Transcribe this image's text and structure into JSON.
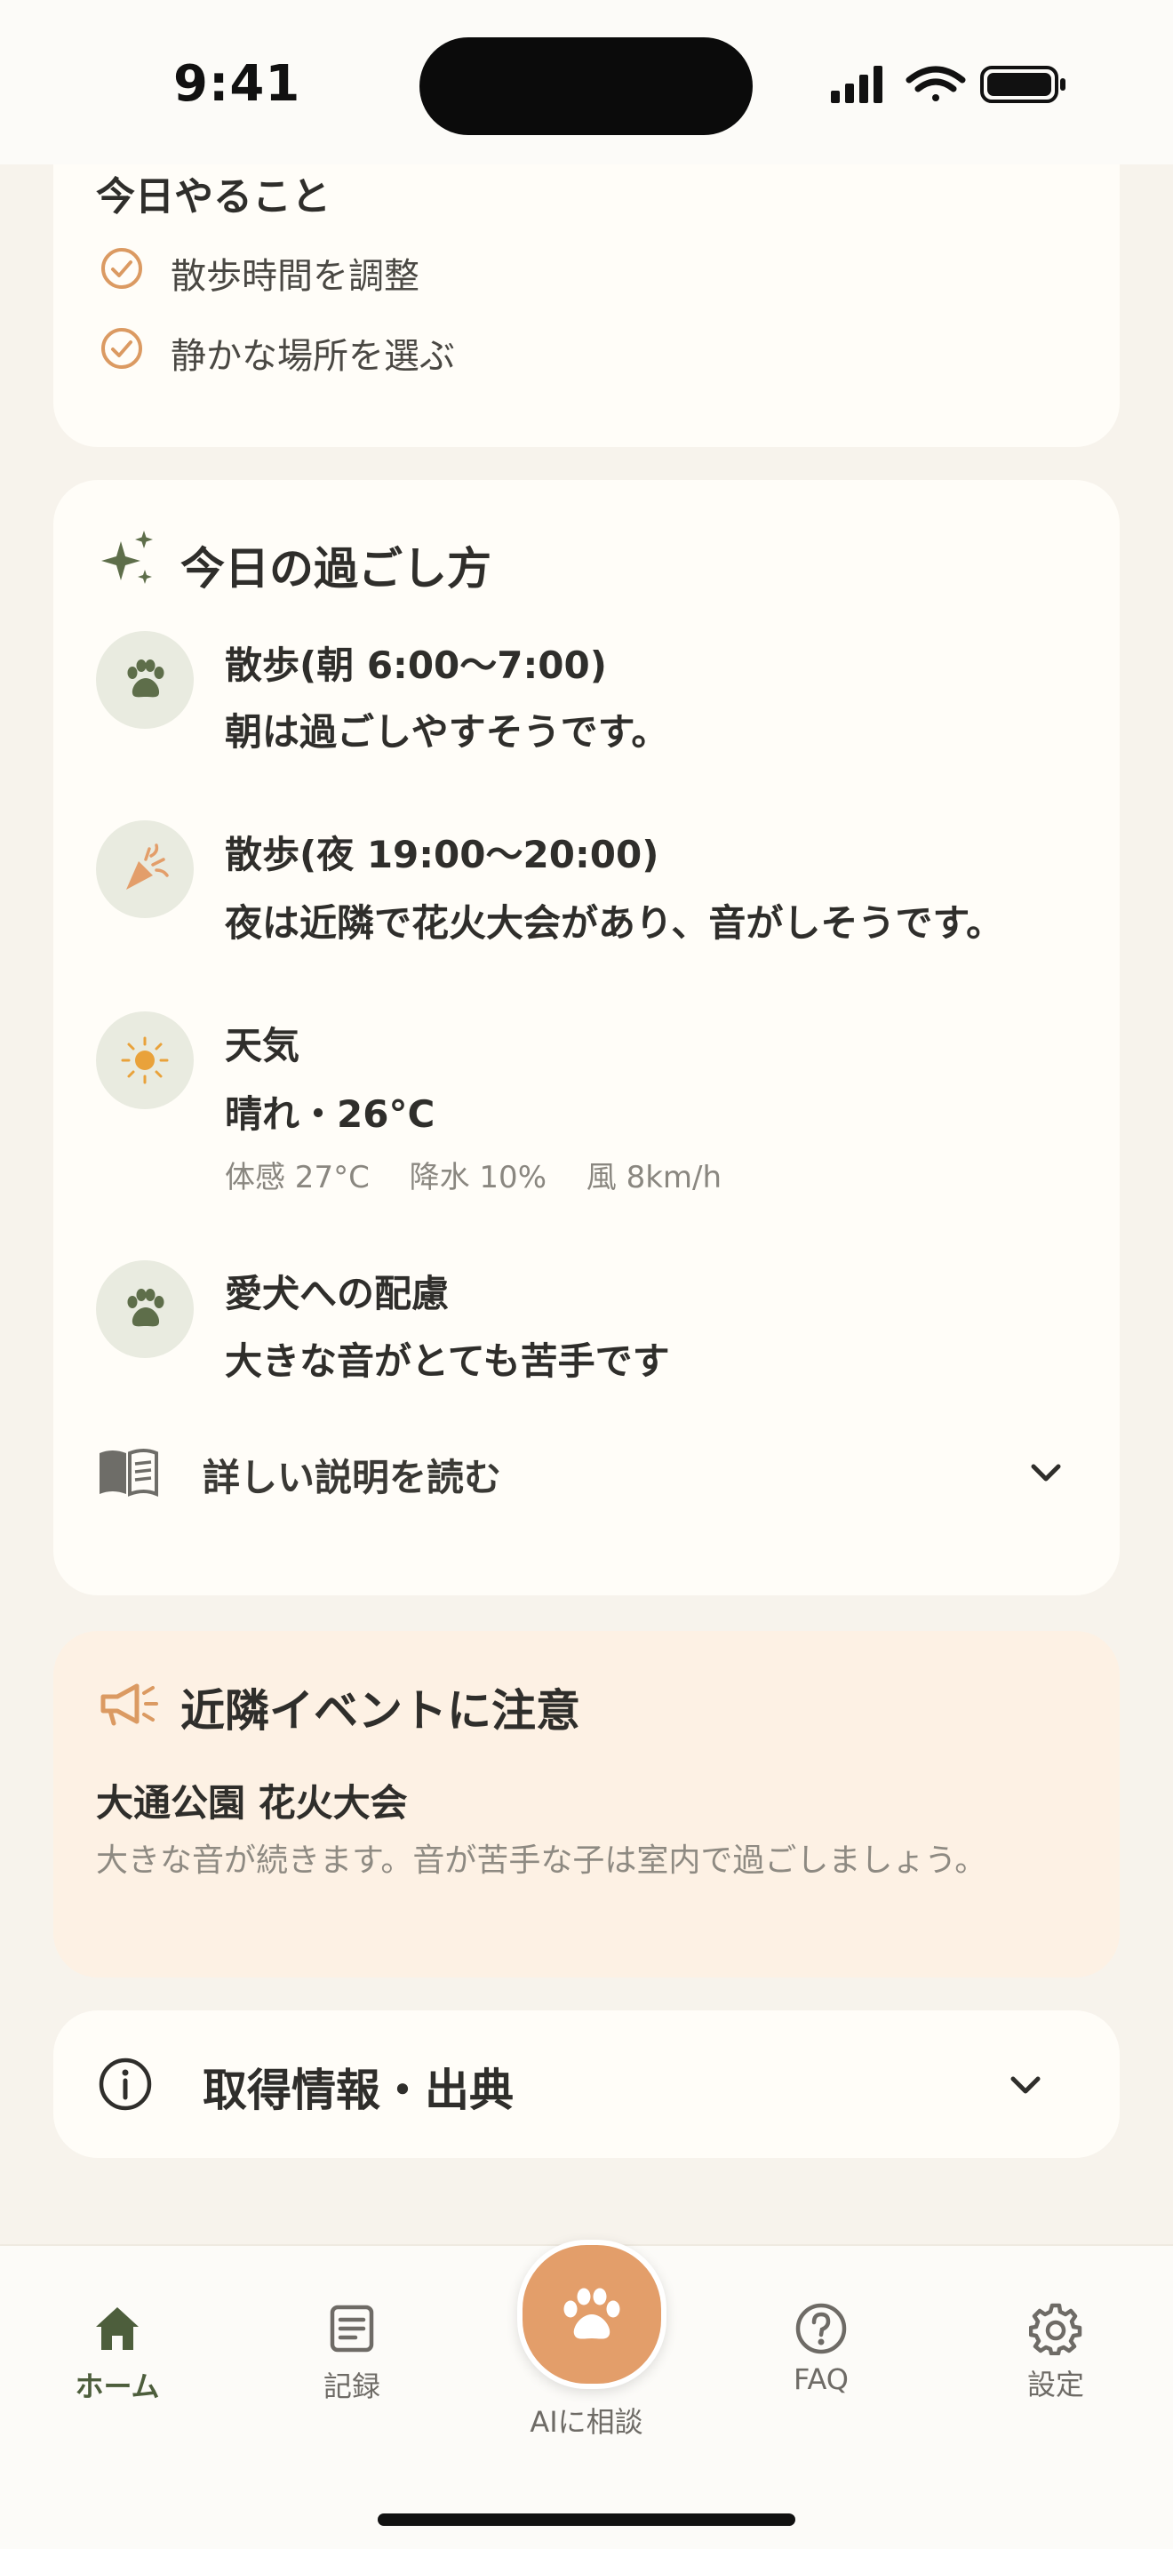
{
  "status_bar": {
    "time": "9:41"
  },
  "todo": {
    "heading": "今日やること",
    "items": [
      "散歩時間を調整",
      "静かな場所を選ぶ"
    ]
  },
  "today": {
    "title": "今日の過ごし方",
    "items": [
      {
        "icon": "paw-icon",
        "title": "散歩(朝 6:00〜7:00)",
        "body": "朝は過ごしやすそうです。"
      },
      {
        "icon": "firework-popper-icon",
        "title": "散歩(夜 19:00〜20:00)",
        "body": "夜は近隣で花火大会があり、音がしそうです。"
      },
      {
        "icon": "sun-icon",
        "title": "天気",
        "body": "晴れ・26°C",
        "sub": "体感 27°C　 降水 10%　 風 8km/h"
      },
      {
        "icon": "paw-icon",
        "title": "愛犬への配慮",
        "body": "大きな音がとても苦手です"
      }
    ],
    "read_more": "詳しい説明を読む"
  },
  "event": {
    "title": "近隣イベントに注意",
    "name": "大通公園 花火大会",
    "description": "大きな音が続きます。音が苦手な子は室内で過ごしましょう。"
  },
  "source": {
    "title": "取得情報・出典"
  },
  "tabbar": {
    "items": [
      {
        "label": "ホーム",
        "icon": "home-icon",
        "active": true
      },
      {
        "label": "記録",
        "icon": "record-icon",
        "active": false
      },
      {
        "label": "AIに相談",
        "icon": "paw-icon",
        "active": false
      },
      {
        "label": "FAQ",
        "icon": "question-icon",
        "active": false
      },
      {
        "label": "設定",
        "icon": "gear-icon",
        "active": false
      }
    ]
  },
  "colors": {
    "accent_orange": "#E39E6A",
    "accent_green": "#5E6E4A",
    "background": "#F7F3EC",
    "card": "#FFFDF8",
    "event_card": "#FDF1E4"
  }
}
